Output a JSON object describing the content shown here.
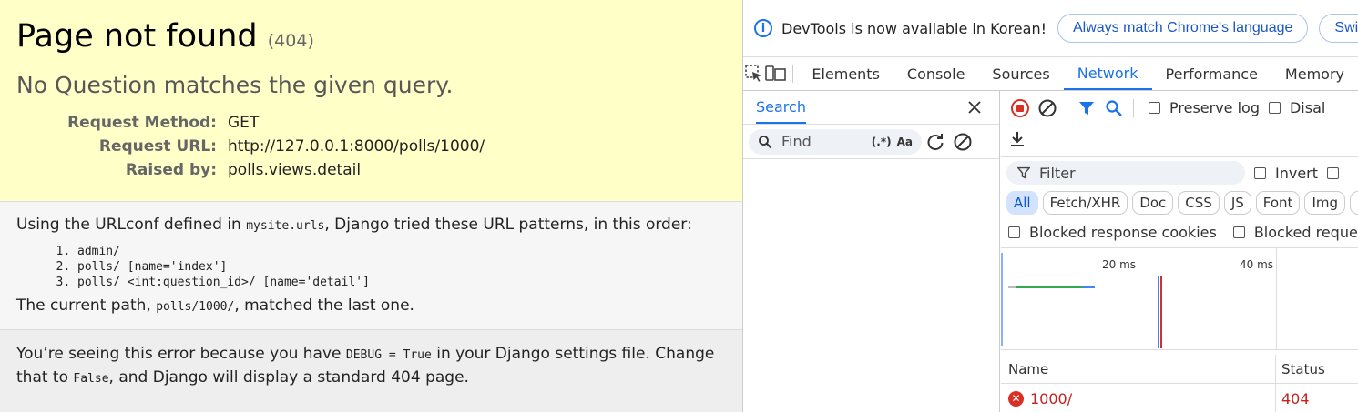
{
  "django": {
    "title": "Page not found",
    "status_code": "(404)",
    "exception_message": "No Question matches the given query.",
    "meta": [
      {
        "label": "Request Method:",
        "value": "GET"
      },
      {
        "label": "Request URL:",
        "value": "http://127.0.0.1:8000/polls/1000/"
      },
      {
        "label": "Raised by:",
        "value": "polls.views.detail"
      }
    ],
    "info_prefix": "Using the URLconf defined in ",
    "info_urlconf": "mysite.urls",
    "info_suffix": ", Django tried these URL patterns, in this order:",
    "patterns": [
      "admin/",
      "polls/ [name='index']",
      "polls/ <int:question_id>/ [name='detail']"
    ],
    "current_path_prefix": "The current path, ",
    "current_path": "polls/1000/",
    "current_path_suffix": ", matched the last one.",
    "explanation": {
      "part1": "You’re seeing this error because you have ",
      "code1": "DEBUG = True",
      "part2": " in your Django settings file. Change that to ",
      "code2": "False",
      "part3": ", and Django will display a standard 404 page."
    }
  },
  "devtools": {
    "infobar": {
      "message": "DevTools is now available in Korean!",
      "match_button": "Always match Chrome's language",
      "switch_button": "Switc"
    },
    "tabs": [
      "Elements",
      "Console",
      "Sources",
      "Network",
      "Performance",
      "Memory"
    ],
    "active_tab": "Network",
    "search": {
      "title": "Search",
      "placeholder": "Find",
      "regex_label": "(.*)",
      "case_label": "Aa"
    },
    "network": {
      "preserve_log": "Preserve log",
      "disable_cache": "Disal",
      "filter_placeholder": "Filter",
      "invert": "Invert",
      "chips": [
        "All",
        "Fetch/XHR",
        "Doc",
        "CSS",
        "JS",
        "Font",
        "Img",
        "M"
      ],
      "blocked_cookies": "Blocked response cookies",
      "blocked_requests": "Blocked requests",
      "timeline_labels": [
        "20 ms",
        "40 ms"
      ],
      "columns": [
        "Name",
        "Status"
      ],
      "rows": [
        {
          "name": "1000/",
          "status": "404"
        }
      ]
    },
    "colors": {
      "accent": "#1a73e8",
      "error": "#d93025",
      "record": "#d93025"
    }
  }
}
